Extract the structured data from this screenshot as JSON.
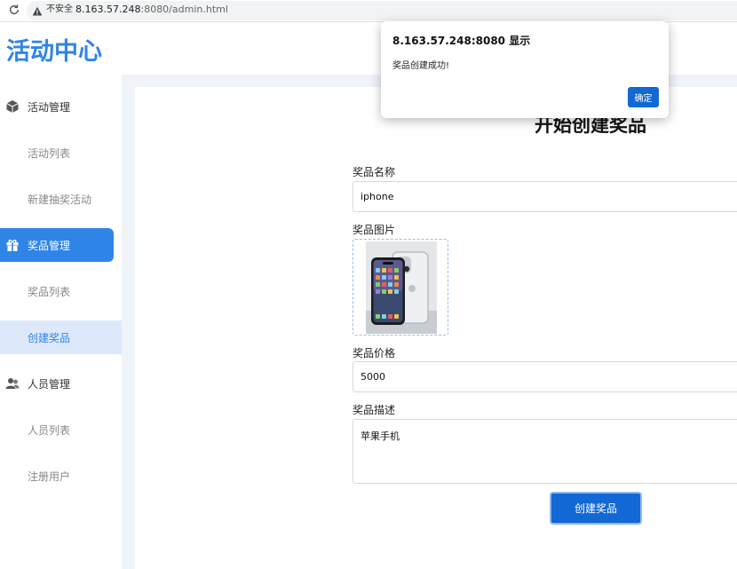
{
  "browser": {
    "insecure_label": "不安全",
    "url_host": "8.163.57.248",
    "url_rest": ":8080/admin.html"
  },
  "sidebar": {
    "logo": "活动中心",
    "groups": [
      {
        "label": "活动管理",
        "icon": "cube-icon",
        "items": [
          "活动列表",
          "新建抽奖活动"
        ]
      },
      {
        "label": "奖品管理",
        "icon": "gift-icon",
        "items": [
          "奖品列表",
          "创建奖品"
        ]
      },
      {
        "label": "人员管理",
        "icon": "users-icon",
        "items": [
          "人员列表",
          "注册用户"
        ]
      }
    ],
    "active_group": "奖品管理",
    "active_item": "创建奖品"
  },
  "form": {
    "title": "开始创建奖品",
    "name_label": "奖品名称",
    "name_value": "iphone",
    "image_label": "奖品图片",
    "price_label": "奖品价格",
    "price_value": "5000",
    "desc_label": "奖品描述",
    "desc_value": "苹果手机",
    "submit_label": "创建奖品"
  },
  "dialog": {
    "title": "8.163.57.248:8080 显示",
    "message": "奖品创建成功!",
    "ok_label": "确定"
  },
  "colors": {
    "accent": "#2f84e8",
    "button": "#1268d4",
    "active_sub_bg": "#dde9fb",
    "main_bg": "#f0f3f8"
  }
}
